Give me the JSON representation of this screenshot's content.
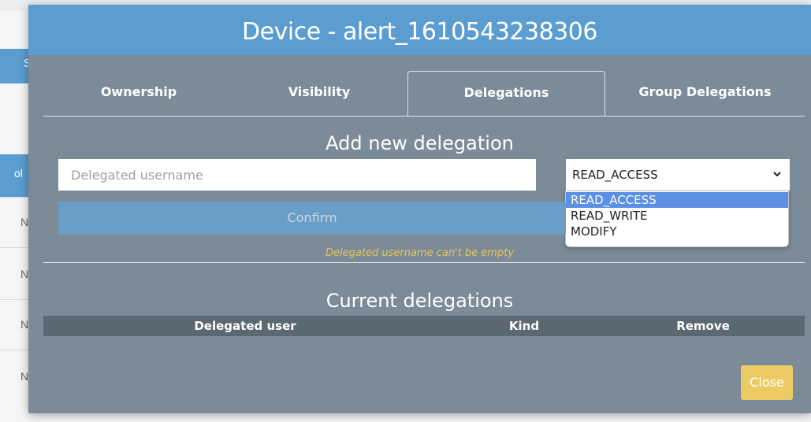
{
  "background": {
    "header_fragment": "S",
    "column_fragment": "ol",
    "row_fragments": [
      "NI",
      "NI",
      "NI",
      "NI"
    ]
  },
  "modal": {
    "title": "Device - alert_1610543238306",
    "tabs": [
      {
        "label": "Ownership",
        "active": false
      },
      {
        "label": "Visibility",
        "active": false
      },
      {
        "label": "Delegations",
        "active": true
      },
      {
        "label": "Group Delegations",
        "active": false
      }
    ],
    "add_section": {
      "title": "Add new delegation",
      "username_placeholder": "Delegated username",
      "username_value": "",
      "kind_selected": "READ_ACCESS",
      "kind_options": [
        "READ_ACCESS",
        "READ_WRITE",
        "MODIFY"
      ],
      "confirm_label": "Confirm",
      "error_text": "Delegated username can't be empty"
    },
    "current_section": {
      "title": "Current delegations",
      "columns": [
        "Delegated user",
        "Kind",
        "Remove"
      ],
      "rows": []
    },
    "close_label": "Close"
  },
  "colors": {
    "header": "#5b9dd1",
    "modal_body": "#7b8b97",
    "close_button": "#eccb64",
    "error_text": "#e8c55a",
    "dropdown_highlight": "#5b90e6"
  }
}
